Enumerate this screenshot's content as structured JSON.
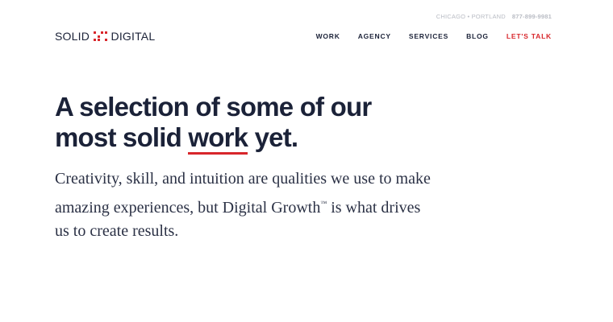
{
  "topbar": {
    "locations": "CHICAGO • PORTLAND",
    "phone": "877-899-9981"
  },
  "logo": {
    "left": "SOLID",
    "right": "DIGITAL",
    "brand_color": "#d8262b"
  },
  "nav": {
    "items": [
      {
        "label": "WORK"
      },
      {
        "label": "AGENCY"
      },
      {
        "label": "SERVICES"
      },
      {
        "label": "BLOG"
      },
      {
        "label": "LET'S TALK"
      }
    ]
  },
  "hero": {
    "headline_part1": "A selection of some of our most solid ",
    "headline_highlight": "work",
    "headline_part2": " yet.",
    "lead_part1": "Creativity, skill, and intuition are qualities we use to make amazing experiences, but Digital Growth",
    "lead_tm": "™",
    "lead_part2": " is what drives us to create results."
  },
  "colors": {
    "text": "#1b2238",
    "accent": "#d8262b"
  }
}
